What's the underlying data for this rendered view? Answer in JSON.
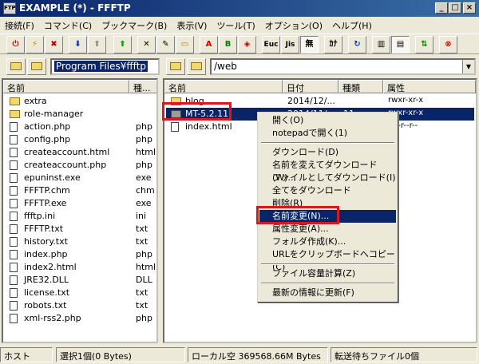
{
  "window": {
    "title": "EXAMPLE (*) - FFFTP",
    "app_icon_text": "FTP",
    "minimize": "_",
    "maximize": "□",
    "close": "×"
  },
  "menu": [
    "接続(F)",
    "コマンド(C)",
    "ブックマーク(B)",
    "表示(V)",
    "ツール(T)",
    "オプション(O)",
    "ヘルプ(H)"
  ],
  "toolbar": {
    "ascii_label": "A",
    "binary_label": "B",
    "euc_label": "Euc",
    "jis_label": "Jis",
    "none_label": "無",
    "kana_label": "ｶﾅ"
  },
  "local": {
    "path": "Program Files¥ffftp",
    "col_name": "名前",
    "col_type": "種...",
    "items": [
      {
        "name": "extra",
        "type": "",
        "kind": "folder"
      },
      {
        "name": "role-manager",
        "type": "",
        "kind": "folder"
      },
      {
        "name": "action.php",
        "type": "php",
        "kind": "file"
      },
      {
        "name": "config.php",
        "type": "php",
        "kind": "file"
      },
      {
        "name": "createaccount.html",
        "type": "html",
        "kind": "file"
      },
      {
        "name": "createaccount.php",
        "type": "php",
        "kind": "file"
      },
      {
        "name": "epuninst.exe",
        "type": "exe",
        "kind": "file"
      },
      {
        "name": "FFFTP.chm",
        "type": "chm",
        "kind": "file"
      },
      {
        "name": "FFFTP.exe",
        "type": "exe",
        "kind": "file"
      },
      {
        "name": "ffftp.ini",
        "type": "ini",
        "kind": "file"
      },
      {
        "name": "FFFTP.txt",
        "type": "txt",
        "kind": "file"
      },
      {
        "name": "history.txt",
        "type": "txt",
        "kind": "file"
      },
      {
        "name": "index.php",
        "type": "php",
        "kind": "file"
      },
      {
        "name": "index2.html",
        "type": "html",
        "kind": "file"
      },
      {
        "name": "JRE32.DLL",
        "type": "DLL",
        "kind": "file"
      },
      {
        "name": "license.txt",
        "type": "txt",
        "kind": "file"
      },
      {
        "name": "robots.txt",
        "type": "txt",
        "kind": "file"
      },
      {
        "name": "xml-rss2.php",
        "type": "php",
        "kind": "file"
      }
    ]
  },
  "remote": {
    "path": "/web",
    "col_name": "名前",
    "col_date": "日付",
    "col_type": "種類",
    "col_attr": "属性",
    "items": [
      {
        "name": "blog",
        "date": "2014/12/...",
        "type": "",
        "attr": "rwxr-xr-x",
        "kind": "folder"
      },
      {
        "name": "MT-5.2.11",
        "date": "2014/11/...",
        "type": "11",
        "attr": "rwxr-xr-x",
        "kind": "folder-gray"
      },
      {
        "name": "index.html",
        "date": "",
        "type": "",
        "attr": "rw-r--r--",
        "kind": "file"
      }
    ]
  },
  "context_menu": [
    {
      "label": "開く(O)"
    },
    {
      "label": "notepadで開く(1)"
    },
    {
      "sep": true
    },
    {
      "label": "ダウンロード(D)"
    },
    {
      "label": "名前を変えてダウンロード(W)..."
    },
    {
      "label": "ファイルとしてダウンロード(I)"
    },
    {
      "label": "全てをダウンロード"
    },
    {
      "label": "削除(R)"
    },
    {
      "label": "名前変更(N)...",
      "highlight": true
    },
    {
      "label": "属性変更(A)..."
    },
    {
      "label": "フォルダ作成(K)..."
    },
    {
      "label": "URLをクリップボードへコピー(C)"
    },
    {
      "sep": true
    },
    {
      "label": "ファイル容量計算(Z)"
    },
    {
      "sep": true
    },
    {
      "label": "最新の情報に更新(F)"
    }
  ],
  "status": {
    "host": "ホスト",
    "selection": "選択1個(0 Bytes)",
    "local_free": "ローカル空 369568.66M Bytes",
    "queue": "転送待ちファイル0個"
  }
}
